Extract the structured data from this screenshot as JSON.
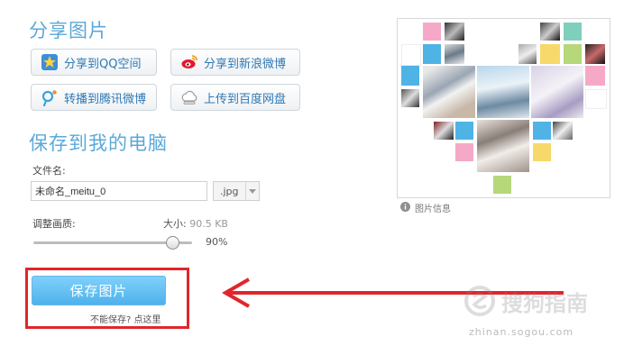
{
  "share": {
    "title": "分享图片",
    "buttons": [
      {
        "label": "分享到QQ空间",
        "icon": "qzone-star-icon"
      },
      {
        "label": "分享到新浪微博",
        "icon": "sina-weibo-icon"
      },
      {
        "label": "转播到腾讯微博",
        "icon": "tencent-weibo-icon"
      },
      {
        "label": "上传到百度网盘",
        "icon": "baidu-cloud-icon"
      }
    ]
  },
  "save": {
    "title": "保存到我的电脑",
    "filename_label": "文件名:",
    "filename_value": "未命名_meitu_0",
    "format_value": ".jpg",
    "quality_label": "调整画质:",
    "size_label": "大小:",
    "size_value": "90.5 KB",
    "quality_value": 0.9,
    "quality_text": "90%",
    "save_button": "保存图片",
    "cannot_save": "不能保存? 点这里"
  },
  "preview": {
    "info_label": "图片信息"
  },
  "watermark": {
    "brand": "搜狗指南",
    "url": "zhinan.sogou.com"
  },
  "colors": {
    "accent": "#5aa8da",
    "annotation_red": "#e0262c",
    "tile_pink": "#f6a9c7",
    "tile_blue": "#4fb3e6",
    "tile_yellow": "#f7d96b",
    "tile_green": "#b6d77a",
    "tile_teal": "#7fcfbd"
  }
}
